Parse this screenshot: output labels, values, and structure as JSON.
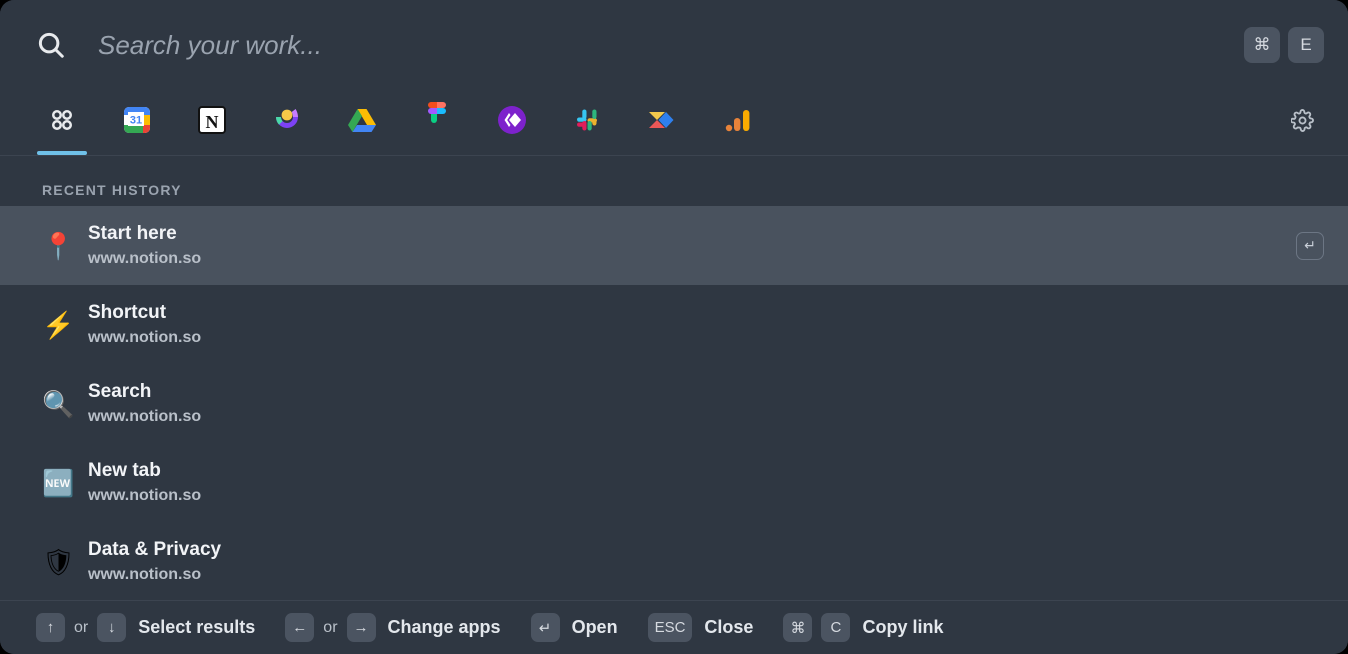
{
  "search": {
    "placeholder": "Search your work...",
    "value": "",
    "icon": "search-icon",
    "shortcut_keys": [
      "⌘",
      "E"
    ]
  },
  "tabs": [
    {
      "id": "all-apps",
      "label": "All apps",
      "icon": "four-circles-icon",
      "active": true
    },
    {
      "id": "google-calendar",
      "label": "Google Calendar",
      "icon": "google-calendar-icon",
      "active": false
    },
    {
      "id": "notion",
      "label": "Notion",
      "icon": "notion-icon",
      "active": false
    },
    {
      "id": "gusto",
      "label": "Gusto",
      "icon": "gusto-icon",
      "active": false
    },
    {
      "id": "google-drive",
      "label": "Google Drive",
      "icon": "google-drive-icon",
      "active": false
    },
    {
      "id": "figma",
      "label": "Figma",
      "icon": "figma-icon",
      "active": false
    },
    {
      "id": "craft",
      "label": "Craft",
      "icon": "craft-icon",
      "active": false
    },
    {
      "id": "slack",
      "label": "Slack",
      "icon": "slack-icon",
      "active": false
    },
    {
      "id": "front",
      "label": "Front",
      "icon": "front-icon",
      "active": false
    },
    {
      "id": "google-analytics",
      "label": "Google Analytics",
      "icon": "google-analytics-icon",
      "active": false
    }
  ],
  "settings": {
    "icon": "gear-icon",
    "label": "Settings"
  },
  "results": {
    "section_title": "RECENT HISTORY",
    "items": [
      {
        "emoji": "📍",
        "emoji_name": "pushpin-emoji",
        "title": "Start here",
        "url": "www.notion.so",
        "selected": true,
        "enter_key": "↵"
      },
      {
        "emoji": "⚡",
        "emoji_name": "lightning-emoji",
        "title": "Shortcut",
        "url": "www.notion.so",
        "selected": false,
        "enter_key": ""
      },
      {
        "emoji": "🔍",
        "emoji_name": "magnifier-emoji",
        "title": "Search",
        "url": "www.notion.so",
        "selected": false,
        "enter_key": ""
      },
      {
        "emoji": "🆕",
        "emoji_name": "new-badge-emoji",
        "title": "New tab",
        "url": "www.notion.so",
        "selected": false,
        "enter_key": ""
      },
      {
        "emoji": "🛡",
        "emoji_name": "shield-emoji",
        "title": "Data & Privacy",
        "url": "www.notion.so",
        "selected": false,
        "enter_key": ""
      }
    ]
  },
  "footer": {
    "hints": [
      {
        "keys": [
          "↑"
        ],
        "or": "or",
        "keys2": [
          "↓"
        ],
        "label": "Select results"
      },
      {
        "keys": [
          "←"
        ],
        "or": "or",
        "keys2": [
          "→"
        ],
        "label": "Change apps"
      },
      {
        "keys": [
          "↵"
        ],
        "or": "",
        "keys2": [],
        "label": "Open"
      },
      {
        "keys": [
          "ESC"
        ],
        "or": "",
        "keys2": [],
        "label": "Close"
      },
      {
        "keys": [
          "⌘",
          "C"
        ],
        "or": "",
        "keys2": [],
        "label": "Copy link"
      }
    ]
  },
  "colors": {
    "background": "#2f3742",
    "selected_row": "#49525e",
    "accent_underline": "#6fc0e8",
    "key_bg": "#4b5461",
    "text_primary": "#f2f4f7",
    "text_secondary": "#b9c0c9"
  }
}
